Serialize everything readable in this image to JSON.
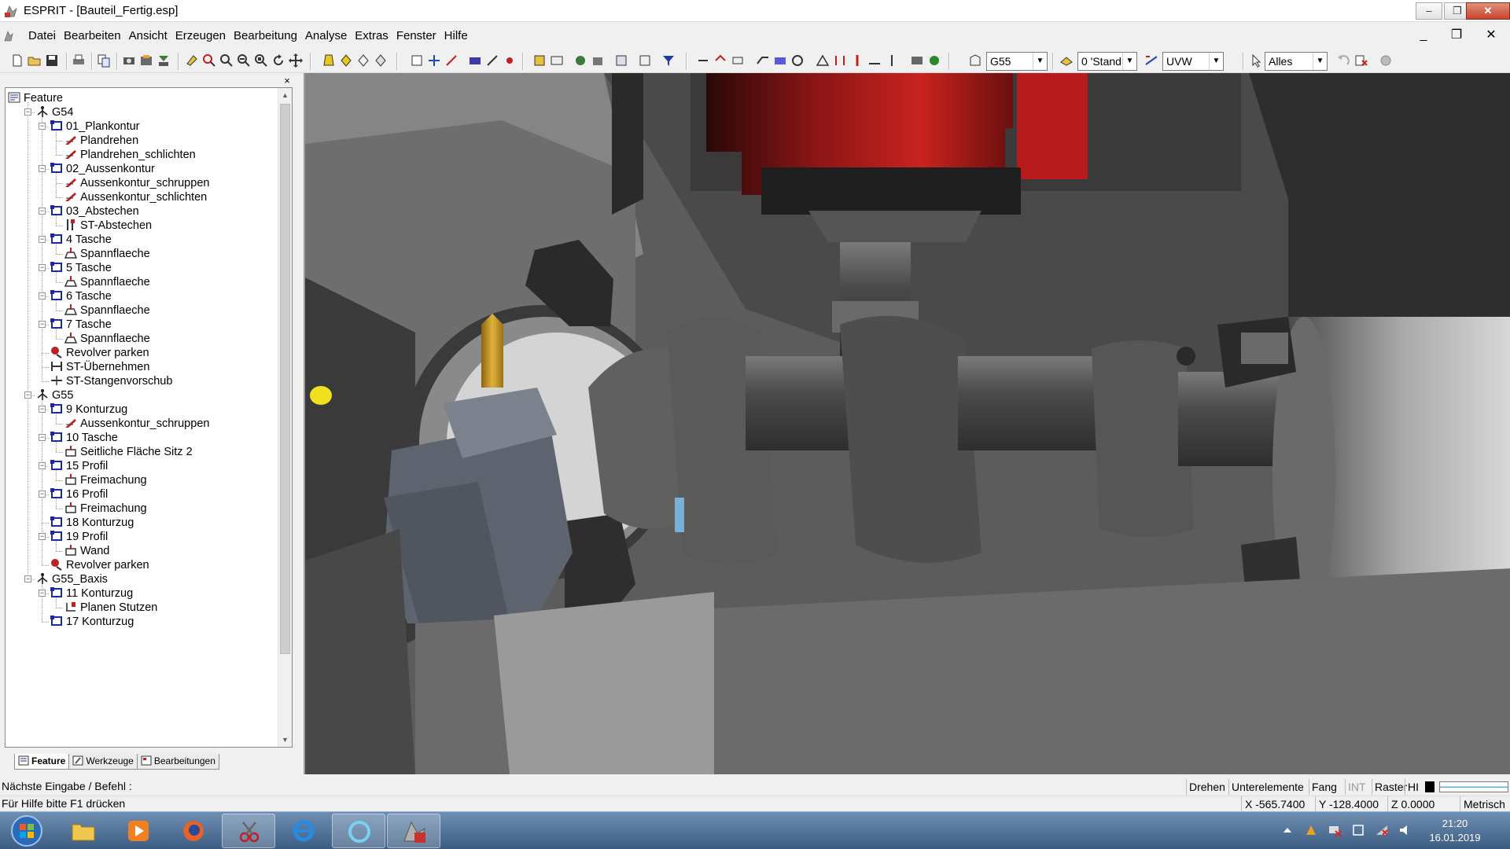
{
  "window": {
    "title": "ESPRIT - [Bauteil_Fertig.esp]",
    "minimize_glyph": "–",
    "restore_glyph": "❐",
    "close_glyph": "✕"
  },
  "menu": {
    "items": [
      "Datei",
      "Bearbeiten",
      "Ansicht",
      "Erzeugen",
      "Bearbeitung",
      "Analyse",
      "Extras",
      "Fenster",
      "Hilfe"
    ],
    "mdi_minimize": "_",
    "mdi_restore": "❐",
    "mdi_close": "✕"
  },
  "toolbar": {
    "workcoord_combo": "G55",
    "layer_combo": "0 'Stand",
    "plane_combo": "UVW",
    "selection_combo": "Alles"
  },
  "panel": {
    "close_glyph": "×",
    "tabs": [
      {
        "label": "Feature",
        "icon": "feature-tab-icon"
      },
      {
        "label": "Werkzeuge",
        "icon": "tools-tab-icon"
      },
      {
        "label": "Bearbeitungen",
        "icon": "operations-tab-icon"
      }
    ]
  },
  "tree": [
    {
      "label": "Feature",
      "level": 0,
      "icon": "feature-root-icon"
    },
    {
      "label": "G54",
      "level": 1,
      "icon": "workcoord-icon"
    },
    {
      "label": "01_Plankontur",
      "level": 2,
      "icon": "chain-feature-icon"
    },
    {
      "label": "Plandrehen",
      "level": 3,
      "icon": "turning-op-icon"
    },
    {
      "label": "Plandrehen_schlichten",
      "level": 3,
      "icon": "turning-op-icon"
    },
    {
      "label": "02_Aussenkontur",
      "level": 2,
      "icon": "chain-feature-icon"
    },
    {
      "label": "Aussenkontur_schruppen",
      "level": 3,
      "icon": "turning-op-icon"
    },
    {
      "label": "Aussenkontur_schlichten",
      "level": 3,
      "icon": "turning-op-icon"
    },
    {
      "label": "03_Abstechen",
      "level": 2,
      "icon": "chain-feature-icon"
    },
    {
      "label": "ST-Abstechen",
      "level": 3,
      "icon": "cutoff-op-icon"
    },
    {
      "label": "4 Tasche",
      "level": 2,
      "icon": "chain-feature-icon"
    },
    {
      "label": "Spannflaeche",
      "level": 3,
      "icon": "pocket-op-icon"
    },
    {
      "label": "5 Tasche",
      "level": 2,
      "icon": "chain-feature-icon"
    },
    {
      "label": "Spannflaeche",
      "level": 3,
      "icon": "pocket-op-icon"
    },
    {
      "label": "6 Tasche",
      "level": 2,
      "icon": "chain-feature-icon"
    },
    {
      "label": "Spannflaeche",
      "level": 3,
      "icon": "pocket-op-icon"
    },
    {
      "label": "7 Tasche",
      "level": 2,
      "icon": "chain-feature-icon"
    },
    {
      "label": "Spannflaeche",
      "level": 3,
      "icon": "pocket-op-icon"
    },
    {
      "label": "Revolver parken",
      "level": 2,
      "icon": "turret-park-icon"
    },
    {
      "label": "ST-Übernehmen",
      "level": 2,
      "icon": "transfer-op-icon"
    },
    {
      "label": "ST-Stangenvorschub",
      "level": 2,
      "icon": "bar-feed-op-icon"
    },
    {
      "label": "G55",
      "level": 1,
      "icon": "workcoord-icon"
    },
    {
      "label": "9 Konturzug",
      "level": 2,
      "icon": "chain-feature-icon"
    },
    {
      "label": "Aussenkontur_schruppen",
      "level": 3,
      "icon": "turning-op-icon"
    },
    {
      "label": "10 Tasche",
      "level": 2,
      "icon": "chain-feature-icon"
    },
    {
      "label": "Seitliche Fläche Sitz 2",
      "level": 3,
      "icon": "milling-op-icon"
    },
    {
      "label": "15 Profil",
      "level": 2,
      "icon": "chain-feature-icon"
    },
    {
      "label": "Freimachung",
      "level": 3,
      "icon": "milling-op-icon"
    },
    {
      "label": "16 Profil",
      "level": 2,
      "icon": "chain-feature-icon"
    },
    {
      "label": "Freimachung",
      "level": 3,
      "icon": "milling-op-icon"
    },
    {
      "label": "18 Konturzug",
      "level": 2,
      "icon": "chain-feature-icon"
    },
    {
      "label": "19 Profil",
      "level": 2,
      "icon": "chain-feature-icon"
    },
    {
      "label": "Wand",
      "level": 3,
      "icon": "milling-op-icon"
    },
    {
      "label": "Revolver parken",
      "level": 2,
      "icon": "turret-park-icon"
    },
    {
      "label": "G55_Baxis",
      "level": 1,
      "icon": "workcoord-icon"
    },
    {
      "label": "11 Konturzug",
      "level": 2,
      "icon": "chain-feature-icon"
    },
    {
      "label": "Planen Stutzen",
      "level": 3,
      "icon": "facing-op-icon"
    },
    {
      "label": "17 Konturzug",
      "level": 2,
      "icon": "chain-feature-icon"
    }
  ],
  "status": {
    "prompt": "Nächste Eingabe / Befehl :",
    "help": "Für Hilfe bitte F1 drücken",
    "modes": [
      "Drehen",
      "Unterelemente",
      "Fang",
      "INT",
      "Raster",
      "HI"
    ],
    "x": "X -565.7400",
    "y": "Y -128.4000",
    "z": "Z 0.0000",
    "units": "Metrisch"
  },
  "taskbar": {
    "time": "21:20",
    "date": "16.01.2019"
  },
  "colors": {
    "spindle_red": "#c0201f",
    "tree_blue_icon": "#1c2a9c",
    "taskbar": "#4a6c94",
    "tool_gold": "#d9a531"
  }
}
